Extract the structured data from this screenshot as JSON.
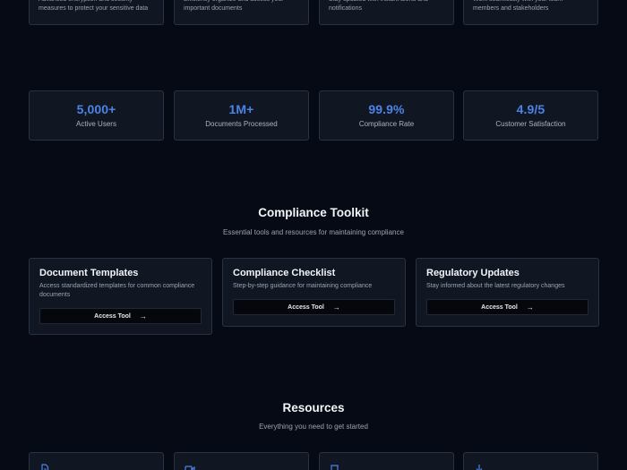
{
  "features": [
    {
      "desc": "Advanced encryption and security measures to protect your sensitive data"
    },
    {
      "desc": "Efficiently organize and access your important documents"
    },
    {
      "desc": "Stay updated with instant alerts and notifications"
    },
    {
      "desc": "Work seamlessly with your team members and stakeholders"
    }
  ],
  "stats": [
    {
      "value": "5,000+",
      "label": "Active Users"
    },
    {
      "value": "1M+",
      "label": "Documents Processed"
    },
    {
      "value": "99.9%",
      "label": "Compliance Rate"
    },
    {
      "value": "4.9/5",
      "label": "Customer Satisfaction"
    }
  ],
  "toolkit": {
    "title": "Compliance Toolkit",
    "subtitle": "Essential tools and resources for maintaining compliance",
    "tools": [
      {
        "title": "Document Templates",
        "desc": "Access standardized templates for common compliance documents",
        "button": "Access Tool"
      },
      {
        "title": "Compliance Checklist",
        "desc": "Step-by-step guidance for maintaining compliance",
        "button": "Access Tool"
      },
      {
        "title": "Regulatory Updates",
        "desc": "Stay informed about the latest regulatory changes",
        "button": "Access Tool"
      }
    ]
  },
  "resources": {
    "title": "Resources",
    "subtitle": "Everything you need to get started",
    "icons": [
      "document-icon",
      "video-icon",
      "book-icon",
      "download-icon"
    ]
  },
  "colors": {
    "accent": "#4d82e6",
    "background": "#060a14",
    "card": "#111722"
  }
}
